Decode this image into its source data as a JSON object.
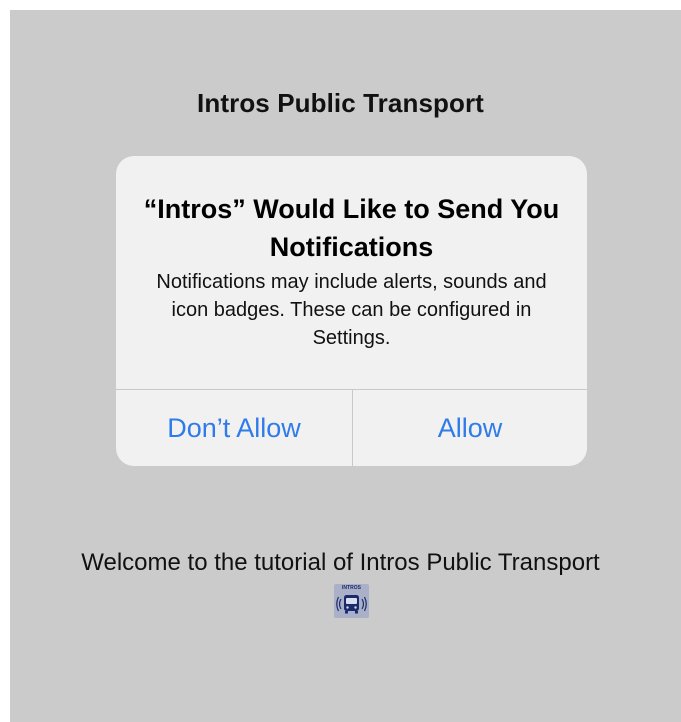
{
  "app": {
    "title": "Intros Public Transport"
  },
  "alert": {
    "title": "“Intros” Would Like to Send You Notifications",
    "message": "Notifications may include alerts, sounds and icon badges. These can be configured in Settings.",
    "dont_allow_label": "Don’t Allow",
    "allow_label": "Allow"
  },
  "welcome": {
    "text": "Welcome to the tutorial of Intros Public Transport"
  },
  "logo": {
    "text": "INTROS",
    "icon": "bus-icon"
  },
  "colors": {
    "background": "#cbcbcb",
    "alert_background": "#f1f1f1",
    "button_blue": "#2f7bea",
    "logo_blue": "#1b2a6b"
  }
}
